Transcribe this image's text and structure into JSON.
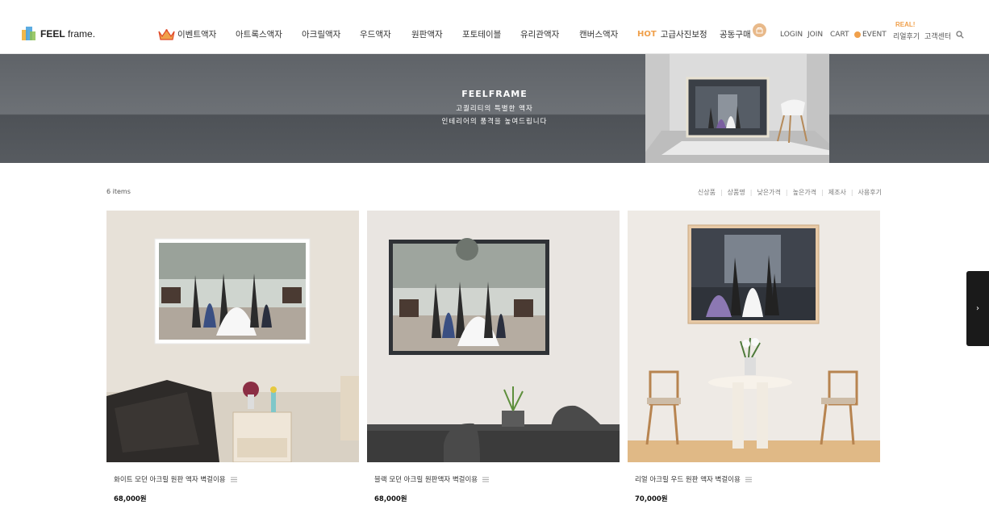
{
  "brand": {
    "bold": "FEEL",
    "light": "frame."
  },
  "nav": {
    "items": [
      "이벤트액자",
      "아트록스액자",
      "아크릴액자",
      "우드액자",
      "원판액자",
      "포토테이블",
      "유리관액자",
      "캔버스액자"
    ],
    "hot_tag": "HOT",
    "hot_item": "고급사진보정",
    "group": "공동구매"
  },
  "util": {
    "login": "LOGIN",
    "join": "JOIN",
    "cart": "CART",
    "event": "EVENT",
    "real_tag": "REAL!",
    "review": "리얼후기",
    "support": "고객센터"
  },
  "banner": {
    "title": "FEELFRAME",
    "line1": "고퀄리티의 특별한 액자",
    "line2": "인테리어의 품격을 높여드립니다"
  },
  "list": {
    "count": "6 items",
    "sort": [
      "신상품",
      "상품명",
      "낮은가격",
      "높은가격",
      "제조사",
      "사용후기"
    ]
  },
  "products": [
    {
      "name": "화이트 모던 아크릴 원판 액자 벽걸이용",
      "price": "68,000원"
    },
    {
      "name": "블랙 모던 아크릴 원판액자 벽걸이용",
      "price": "68,000원"
    },
    {
      "name": "리얼 아크릴 우드 원판 액자 벽걸이용",
      "price": "70,000원"
    }
  ],
  "colors": {
    "accent": "#f0a04b",
    "banner": "#5f6368",
    "next_button": "#1a1a1a"
  }
}
